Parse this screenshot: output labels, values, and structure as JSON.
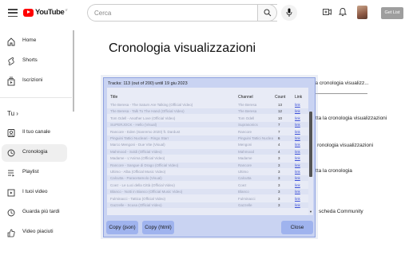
{
  "header": {
    "logo_text": "YouTube",
    "logo_sup": "IT",
    "search_placeholder": "Cerca",
    "get_list_label": "Get List"
  },
  "sidebar": {
    "items_top": [
      {
        "label": "Home",
        "icon": "home-icon"
      },
      {
        "label": "Shorts",
        "icon": "shorts-icon"
      },
      {
        "label": "Iscrizioni",
        "icon": "subscriptions-icon"
      }
    ],
    "section_label": "Tu",
    "items_bottom": [
      {
        "label": "Il tuo canale",
        "icon": "channel-icon"
      },
      {
        "label": "Cronologia",
        "icon": "history-icon"
      },
      {
        "label": "Playlist",
        "icon": "playlist-icon"
      },
      {
        "label": "I tuoi video",
        "icon": "your-videos-icon"
      },
      {
        "label": "Guarda più tardi",
        "icon": "watch-later-icon"
      },
      {
        "label": "Video piaciuti",
        "icon": "liked-icon"
      }
    ]
  },
  "main": {
    "title": "Cronologia visualizzazioni",
    "right_items": [
      "la cronologia visualizz...",
      "tta la cronologia visualizzazioni",
      "ronologia visualizzazioni",
      "tta la cronologia",
      "scheda Community"
    ]
  },
  "dialog": {
    "header": "Tracks: 113 (out of 200) until 19 giu 2023",
    "columns": {
      "title": "Title",
      "channel": "Channel",
      "count": "Count",
      "link": "Link"
    },
    "rows": [
      {
        "title": "The Beresa - The Saturn Are Talking (Official Video)",
        "channel": "The Beresa",
        "count": "13",
        "link": "link"
      },
      {
        "title": "The Beresa - Talk To The Hand (Official Video)",
        "channel": "The Beresa",
        "count": "12",
        "link": "link"
      },
      {
        "title": "Tom Odell - Another Love (Official Video)",
        "channel": "Tom Odell",
        "count": "10",
        "link": "link"
      },
      {
        "title": "SUPERJOCK - Hello (Visual)",
        "channel": "Suprasonics",
        "count": "7",
        "link": "link"
      },
      {
        "title": "Rancore - Eden (Sanremo 2020) ft. Dardust",
        "channel": "Rancore",
        "count": "7",
        "link": "link"
      },
      {
        "title": "Pinguini Tattici Nucleari - Ringo Starr",
        "channel": "Pinguini Tattici Nucleari",
        "count": "6",
        "link": "link"
      },
      {
        "title": "Marco Mengoni - Due Vite (Visual)",
        "channel": "Mengoni",
        "count": "4",
        "link": "link"
      },
      {
        "title": "Mahmood - Soldi (Official Video)",
        "channel": "Mahmood",
        "count": "4",
        "link": "link"
      },
      {
        "title": "Madame - L'Anima (Official Video)",
        "channel": "Madame",
        "count": "3",
        "link": "link"
      },
      {
        "title": "Rancore - Sangue di Drago (Official Video)",
        "channel": "Rancore",
        "count": "3",
        "link": "link"
      },
      {
        "title": "Ultimo - Alba (Official Music Video)",
        "channel": "Ultimo",
        "count": "3",
        "link": "link"
      },
      {
        "title": "Calcutta - Paracetamolo (Visual)",
        "channel": "Calcutta",
        "count": "3",
        "link": "link"
      },
      {
        "title": "Coez - Le Luci della Città (Official Video)",
        "channel": "Coez",
        "count": "3",
        "link": "link"
      },
      {
        "title": "Blanco - Notti in Bianco (Official Music Video)",
        "channel": "Blanco",
        "count": "3",
        "link": "link"
      },
      {
        "title": "Fulminacci - Tattica (Official Video)",
        "channel": "Fulminacci",
        "count": "3",
        "link": "link"
      },
      {
        "title": "Gazzelle - Scusa (Official Video)",
        "channel": "Gazzelle",
        "count": "3",
        "link": "link"
      }
    ],
    "buttons": {
      "copy_json": "Copy (json)",
      "copy_html": "Copy (html)",
      "close": "Close"
    }
  }
}
